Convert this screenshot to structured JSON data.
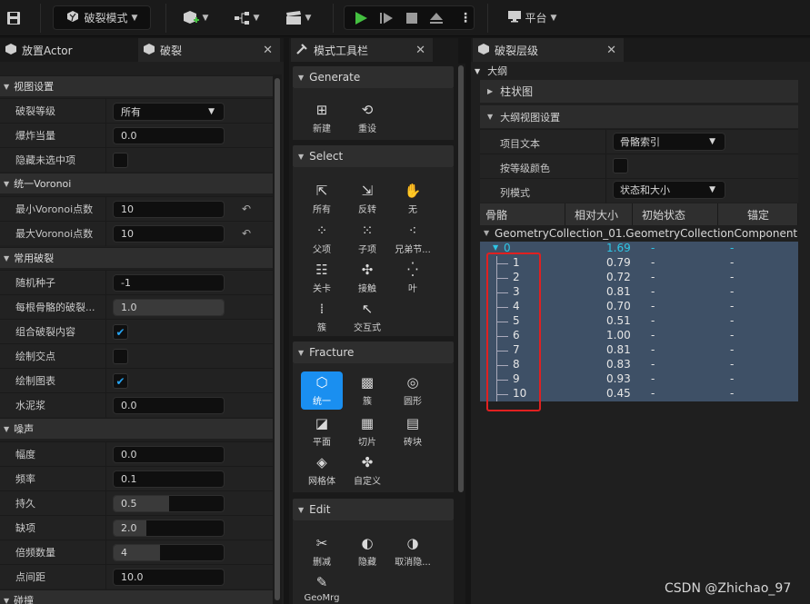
{
  "toolbar": {
    "mode_label": "破裂模式",
    "platform_label": "平台",
    "more_label": "⋮"
  },
  "left_panel": {
    "tabs": [
      {
        "label": "放置Actor"
      },
      {
        "label": "破裂"
      }
    ],
    "categories": {
      "view": "视图设置",
      "voronoi": "统一Voronoi",
      "common": "常用破裂",
      "noise": "噪声",
      "collision": "碰撞"
    },
    "rows": {
      "fracture_level": {
        "label": "破裂等级",
        "value": "所有"
      },
      "explode_amount": {
        "label": "爆炸当量",
        "value": "0.0"
      },
      "hide_unselected": {
        "label": "隐藏未选中项"
      },
      "min_voronoi": {
        "label": "最小Voronoi点数",
        "value": "10"
      },
      "max_voronoi": {
        "label": "最大Voronoi点数",
        "value": "10"
      },
      "random_seed": {
        "label": "随机种子",
        "value": "-1"
      },
      "chance_per_bone": {
        "label": "每根骨骼的破裂...",
        "value": "1.0",
        "fill": 1.0
      },
      "group_fracture": {
        "label": "组合破裂内容",
        "checked": true
      },
      "draw_sites": {
        "label": "绘制交点",
        "checked": false
      },
      "draw_diagram": {
        "label": "绘制图表",
        "checked": true
      },
      "grout": {
        "label": "水泥浆",
        "value": "0.0"
      },
      "amplitude": {
        "label": "幅度",
        "value": "0.0"
      },
      "frequency": {
        "label": "频率",
        "value": "0.1"
      },
      "persistence": {
        "label": "持久",
        "value": "0.5",
        "fill": 0.5
      },
      "lacunarity": {
        "label": "缺项",
        "value": "2.0",
        "fill": 0.3
      },
      "octaves": {
        "label": "倍频数量",
        "value": "4",
        "fill": 0.42
      },
      "point_spacing": {
        "label": "点间距",
        "value": "10.0"
      }
    }
  },
  "mode_panel": {
    "tab_label": "模式工具栏",
    "sections": {
      "generate": {
        "title": "Generate",
        "tools": [
          "新建",
          "重设"
        ]
      },
      "select": {
        "title": "Select",
        "tools": [
          "所有",
          "反转",
          "无",
          "父项",
          "子项",
          "兄弟节...",
          "关卡",
          "接触",
          "叶",
          "簇",
          "交互式"
        ]
      },
      "fracture": {
        "title": "Fracture",
        "tools": [
          "统一",
          "簇",
          "圆形",
          "平面",
          "切片",
          "砖块",
          "网格体",
          "自定义"
        ]
      },
      "edit": {
        "title": "Edit",
        "tools": [
          "删减",
          "隐藏",
          "取消隐...",
          "GeoMrg"
        ]
      }
    }
  },
  "right_panel": {
    "tab_label": "破裂层级",
    "outline_label": "大纲",
    "histogram_label": "柱状图",
    "outline_settings_label": "大纲视图设置",
    "rows": {
      "item_text": {
        "label": "项目文本",
        "value": "骨骼索引"
      },
      "color_by_level": {
        "label": "按等级颜色"
      },
      "column_mode": {
        "label": "列模式",
        "value": "状态和大小"
      }
    },
    "columns": [
      "骨骼",
      "相对大小",
      "初始状态",
      "锚定"
    ],
    "root": {
      "name": "GeometryCollection_01.GeometryCollectionComponent"
    },
    "bones": [
      {
        "index": "0",
        "size": "1.69",
        "state": "-",
        "anchor": "-"
      },
      {
        "index": "1",
        "size": "0.79",
        "state": "-",
        "anchor": "-"
      },
      {
        "index": "2",
        "size": "0.72",
        "state": "-",
        "anchor": "-"
      },
      {
        "index": "3",
        "size": "0.81",
        "state": "-",
        "anchor": "-"
      },
      {
        "index": "4",
        "size": "0.70",
        "state": "-",
        "anchor": "-"
      },
      {
        "index": "5",
        "size": "0.51",
        "state": "-",
        "anchor": "-"
      },
      {
        "index": "6",
        "size": "1.00",
        "state": "-",
        "anchor": "-"
      },
      {
        "index": "7",
        "size": "0.81",
        "state": "-",
        "anchor": "-"
      },
      {
        "index": "8",
        "size": "0.83",
        "state": "-",
        "anchor": "-"
      },
      {
        "index": "9",
        "size": "0.93",
        "state": "-",
        "anchor": "-"
      },
      {
        "index": "10",
        "size": "0.45",
        "state": "-",
        "anchor": "-"
      }
    ]
  },
  "watermark": "CSDN @Zhichao_97",
  "colors": {
    "accent": "#1a8ff0",
    "selection": "#3e5066",
    "highlight_box": "#e02020",
    "play": "#44c040"
  }
}
